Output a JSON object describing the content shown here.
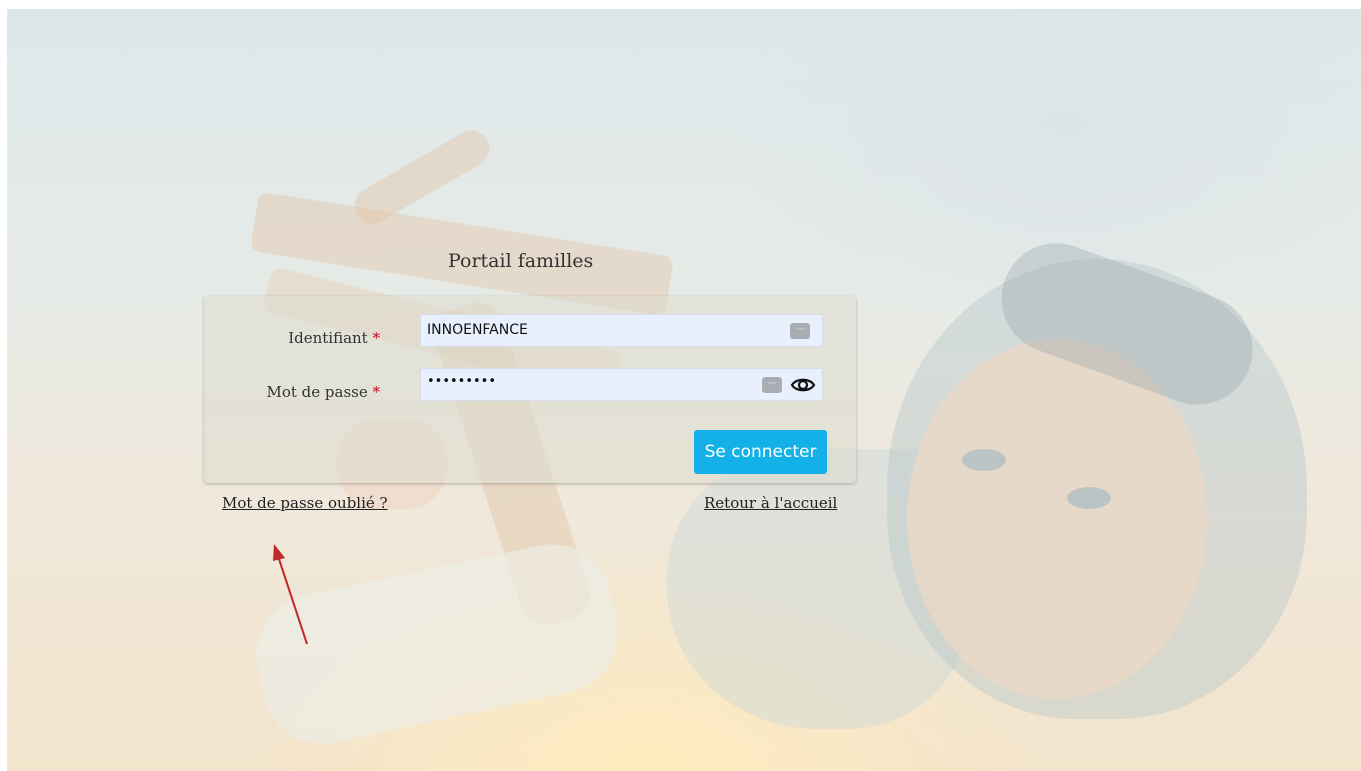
{
  "portal": {
    "title": "Portail familles"
  },
  "form": {
    "username": {
      "label": "Identifiant",
      "required_mark": "*",
      "value": "INNOENFANCE",
      "badge_icon": "credential-autofill-icon",
      "badge_text": "···"
    },
    "password": {
      "label": "Mot de passe",
      "required_mark": "*",
      "value": "•••••••••",
      "badge_icon": "credential-autofill-icon",
      "badge_text": "···",
      "toggle_icon": "eye-icon"
    },
    "submit_label": "Se connecter"
  },
  "links": {
    "forgot_password": "Mot de passe oublié ?",
    "back_home": "Retour à l'accueil"
  },
  "colors": {
    "button_bg": "#14b1e8",
    "input_bg": "#e8f0fe",
    "required": "#d0021b",
    "annotation_arrow": "#c0282a"
  }
}
